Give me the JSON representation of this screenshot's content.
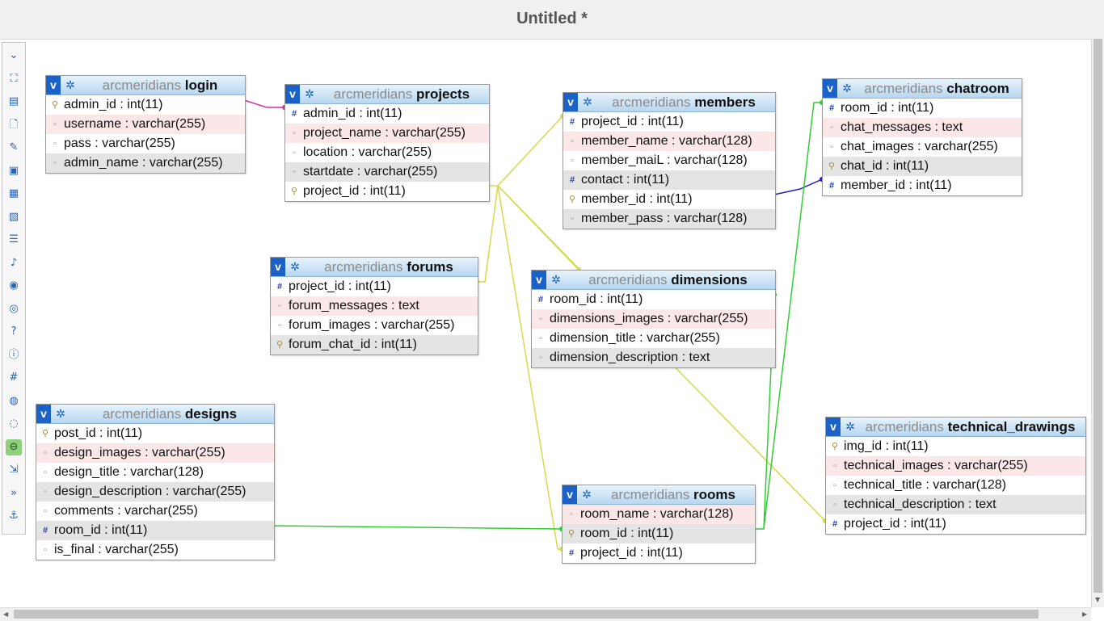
{
  "window": {
    "title": "Untitled *"
  },
  "toolbar": {
    "tools": [
      "collapse-all-icon",
      "fit-screen-icon",
      "add-table-icon",
      "new-page-icon",
      "edit-icon",
      "save-icon",
      "save-as-icon",
      "delete-page-icon",
      "list-icon",
      "export-icon",
      "toggle-relations-icon",
      "angle-icon",
      "help-icon",
      "info-icon",
      "grid-icon",
      "snap-icon",
      "globe-icon",
      "toggle-names-icon",
      "import-icon",
      "back-icon",
      "anchor-icon"
    ],
    "selected_index": 17
  },
  "relation_colors": {
    "login_projects": "#cc33aa",
    "members_chatroom": "#2222bb",
    "projects_links": "#d8d84a",
    "rooms_links": "#33cc33"
  },
  "tables": [
    {
      "db": "arcmeridians",
      "name": "login",
      "fields": [
        {
          "icon": "key",
          "text": "admin_id : int(11)"
        },
        {
          "icon": "dot",
          "text": "username : varchar(255)"
        },
        {
          "icon": "dot",
          "text": "pass : varchar(255)"
        },
        {
          "icon": "dot",
          "text": "admin_name : varchar(255)"
        }
      ]
    },
    {
      "db": "arcmeridians",
      "name": "projects",
      "fields": [
        {
          "icon": "hash",
          "text": "admin_id : int(11)"
        },
        {
          "icon": "dot",
          "text": "project_name : varchar(255)"
        },
        {
          "icon": "dot",
          "text": "location : varchar(255)"
        },
        {
          "icon": "dot",
          "text": "startdate : varchar(255)"
        },
        {
          "icon": "key",
          "text": "project_id : int(11)"
        }
      ]
    },
    {
      "db": "arcmeridians",
      "name": "members",
      "fields": [
        {
          "icon": "hash",
          "text": "project_id : int(11)"
        },
        {
          "icon": "dot",
          "text": "member_name : varchar(128)"
        },
        {
          "icon": "dot",
          "text": "member_maiL : varchar(128)"
        },
        {
          "icon": "hash",
          "text": "contact : int(11)"
        },
        {
          "icon": "key",
          "text": "member_id : int(11)"
        },
        {
          "icon": "dot",
          "text": "member_pass : varchar(128)"
        }
      ]
    },
    {
      "db": "arcmeridians",
      "name": "chatroom",
      "fields": [
        {
          "icon": "hash",
          "text": "room_id : int(11)"
        },
        {
          "icon": "dot",
          "text": "chat_messages : text"
        },
        {
          "icon": "dot",
          "text": "chat_images : varchar(255)"
        },
        {
          "icon": "key",
          "text": "chat_id : int(11)"
        },
        {
          "icon": "hash",
          "text": "member_id : int(11)"
        }
      ]
    },
    {
      "db": "arcmeridians",
      "name": "forums",
      "fields": [
        {
          "icon": "hash",
          "text": "project_id : int(11)"
        },
        {
          "icon": "dot",
          "text": "forum_messages : text"
        },
        {
          "icon": "dot",
          "text": "forum_images : varchar(255)"
        },
        {
          "icon": "key",
          "text": "forum_chat_id : int(11)"
        }
      ]
    },
    {
      "db": "arcmeridians",
      "name": "dimensions",
      "fields": [
        {
          "icon": "hash",
          "text": "room_id : int(11)"
        },
        {
          "icon": "dot",
          "text": "dimensions_images : varchar(255)"
        },
        {
          "icon": "dot",
          "text": "dimension_title : varchar(255)"
        },
        {
          "icon": "dot",
          "text": "dimension_description : text"
        }
      ]
    },
    {
      "db": "arcmeridians",
      "name": "designs",
      "fields": [
        {
          "icon": "key",
          "text": "post_id : int(11)"
        },
        {
          "icon": "dot",
          "text": "design_images : varchar(255)"
        },
        {
          "icon": "dot",
          "text": "design_title : varchar(128)"
        },
        {
          "icon": "dot",
          "text": "design_description : varchar(255)"
        },
        {
          "icon": "dot",
          "text": "comments : varchar(255)"
        },
        {
          "icon": "hash",
          "text": "room_id : int(11)"
        },
        {
          "icon": "dot",
          "text": "is_final : varchar(255)"
        }
      ]
    },
    {
      "db": "arcmeridians",
      "name": "technical_drawings",
      "fields": [
        {
          "icon": "key",
          "text": "img_id : int(11)"
        },
        {
          "icon": "dot",
          "text": "technical_images : varchar(255)"
        },
        {
          "icon": "dot",
          "text": "technical_title : varchar(128)"
        },
        {
          "icon": "dot",
          "text": "technical_description : text"
        },
        {
          "icon": "hash",
          "text": "project_id : int(11)"
        }
      ]
    },
    {
      "db": "arcmeridians",
      "name": "rooms",
      "fields": [
        {
          "icon": "dot",
          "text": "room_name : varchar(128)"
        },
        {
          "icon": "key",
          "text": "room_id : int(11)"
        },
        {
          "icon": "hash",
          "text": "project_id : int(11)"
        }
      ]
    }
  ]
}
